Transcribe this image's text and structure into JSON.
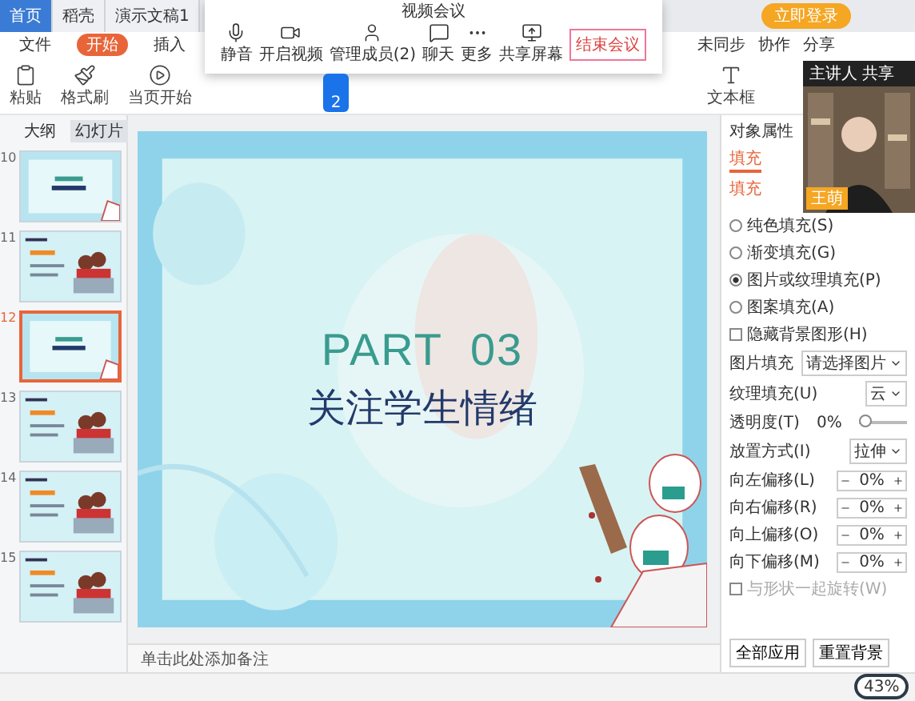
{
  "title_tabs": [
    {
      "label": "首页",
      "selected": true
    },
    {
      "label": "稻壳",
      "selected": false
    },
    {
      "label": "演示文稿1",
      "selected": false
    }
  ],
  "login_button": "立即登录",
  "menu": [
    {
      "label": "文件",
      "selected": false
    },
    {
      "label": "开始",
      "selected": true
    },
    {
      "label": "插入",
      "selected": false
    }
  ],
  "ribbon": [
    {
      "label": "粘贴",
      "kind": "paste"
    },
    {
      "label": "格式刷",
      "kind": "brush"
    },
    {
      "label": "当页开始",
      "kind": "play"
    },
    {
      "label": "文本框",
      "kind": "text"
    }
  ],
  "share_actions": [
    "未同步",
    "协作",
    "分享"
  ],
  "meeting": {
    "title": "视频会议",
    "end_button": "结束会议",
    "hand_count": "2",
    "buttons": [
      {
        "label": "静音",
        "kind": "mic"
      },
      {
        "label": "开启视频",
        "kind": "camera"
      },
      {
        "label": "管理成员(2)",
        "kind": "person"
      },
      {
        "label": "聊天",
        "kind": "chat"
      },
      {
        "label": "更多",
        "kind": "more"
      },
      {
        "label": "共享屏幕",
        "kind": "share"
      }
    ]
  },
  "video": {
    "header": "主讲人 共享",
    "name": "王萌"
  },
  "panel_tabs": [
    {
      "label": "大纲",
      "selected": false
    },
    {
      "label": "幻灯片",
      "selected": true
    }
  ],
  "slides": [
    {
      "number": "10",
      "kind": "title",
      "selected": false
    },
    {
      "number": "11",
      "kind": "content",
      "selected": false
    },
    {
      "number": "12",
      "kind": "title",
      "selected": true
    },
    {
      "number": "13",
      "kind": "content",
      "selected": false
    },
    {
      "number": "14",
      "kind": "content",
      "selected": false
    },
    {
      "number": "15",
      "kind": "content",
      "selected": false
    }
  ],
  "slide": {
    "heading": "PART  03",
    "subtitle": "关注学生情绪"
  },
  "notes_placeholder": "单击此处添加备注",
  "properties": {
    "title": "对象属性",
    "tab": {
      "label": "填充",
      "selected": true
    },
    "section": "填充",
    "options": [
      {
        "kind": "radio",
        "label": "纯色填充(S)",
        "checked": false
      },
      {
        "kind": "radio",
        "label": "渐变填充(G)",
        "checked": false
      },
      {
        "kind": "radio",
        "label": "图片或纹理填充(P)",
        "checked": true
      },
      {
        "kind": "radio",
        "label": "图案填充(A)",
        "checked": false
      },
      {
        "kind": "checkbox",
        "label": "隐藏背景图形(H)",
        "checked": false
      }
    ],
    "selects": [
      {
        "label": "图片填充",
        "value": "请选择图片"
      },
      {
        "label": "纹理填充(U)",
        "value": "云"
      }
    ],
    "transparency": {
      "label": "透明度(T)",
      "level": 0,
      "reading": "0%"
    },
    "placement": {
      "label": "放置方式(I)",
      "value": "拉伸"
    },
    "offsets": [
      {
        "label": "向左偏移(L)",
        "value": "0%"
      },
      {
        "label": "向右偏移(R)",
        "value": "0%"
      },
      {
        "label": "向上偏移(O)",
        "value": "0%"
      },
      {
        "label": "向下偏移(M)",
        "value": "0%"
      }
    ],
    "rotate": {
      "label": "与形状一起旋转(W)",
      "checked": false
    },
    "buttons": [
      "全部应用",
      "重置背景"
    ]
  },
  "speed": "43%"
}
